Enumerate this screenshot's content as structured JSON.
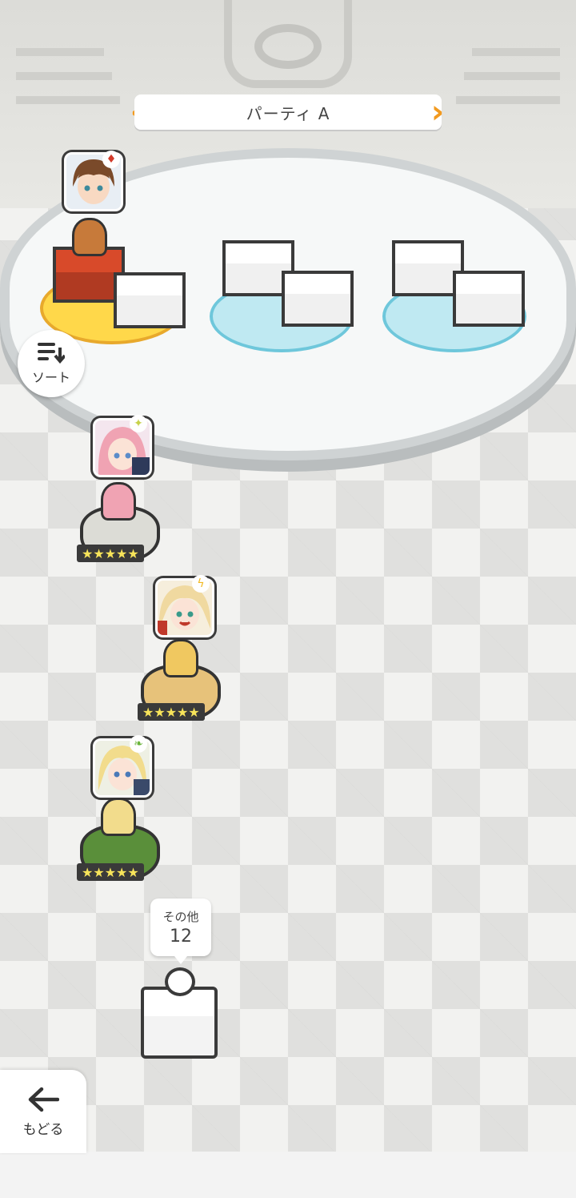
{
  "header": {
    "party_name": "パーティ A",
    "prev_icon": "chevron-left-icon",
    "next_icon": "chevron-right-icon"
  },
  "sort": {
    "label": "ソート",
    "icon": "sort-icon"
  },
  "party_slots": [
    {
      "filled": true,
      "attribute_icon": "fire-icon"
    },
    {
      "filled": false
    },
    {
      "filled": false
    }
  ],
  "characters": [
    {
      "attribute_icon": "sparkle-icon",
      "rarity": 5,
      "stars": "★★★★★"
    },
    {
      "attribute_icon": "lightning-icon",
      "rarity": 5,
      "stars": "★★★★★"
    },
    {
      "attribute_icon": "leaf-icon",
      "rarity": 5,
      "stars": "★★★★★"
    }
  ],
  "others": {
    "label": "その他",
    "count": "12"
  },
  "back": {
    "label": "もどる",
    "icon": "arrow-left-icon"
  },
  "colors": {
    "accent": "#f29a1f",
    "slot_active": "#ffd84a",
    "slot_empty": "#bfe9f2",
    "star": "#f7e45a"
  }
}
